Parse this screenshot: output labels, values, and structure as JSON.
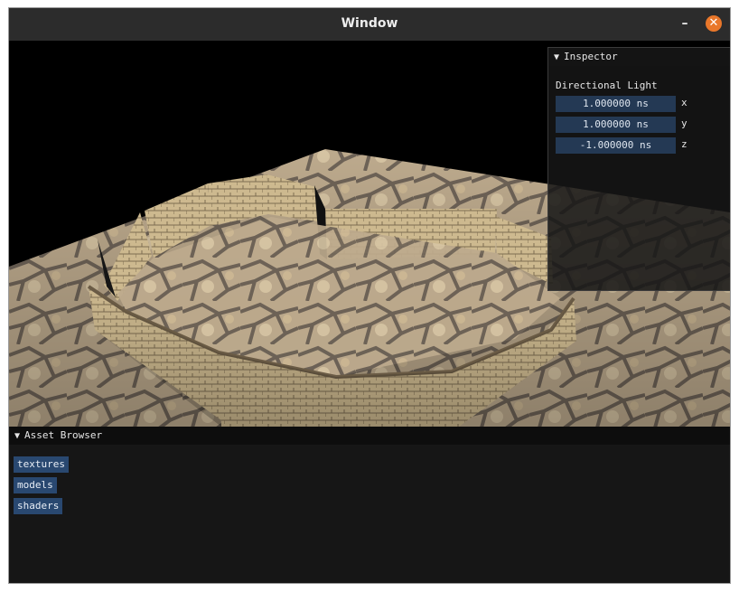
{
  "window": {
    "title": "Window",
    "minimize_glyph": "–",
    "close_glyph": "✕"
  },
  "inspector": {
    "title": "Inspector",
    "section": "Directional Light",
    "fields": [
      {
        "value": "1.000000 ns",
        "axis": "x"
      },
      {
        "value": "1.000000 ns",
        "axis": "y"
      },
      {
        "value": "-1.000000 ns",
        "axis": "z"
      }
    ]
  },
  "asset_browser": {
    "title": "Asset Browser",
    "items": [
      "textures",
      "models",
      "shaders"
    ]
  },
  "colors": {
    "titlebar": "#2c2c2c",
    "close_button": "#e9772a",
    "field_bg": "#243954",
    "asset_button_bg": "#294870",
    "panel_bg": "#161616"
  }
}
